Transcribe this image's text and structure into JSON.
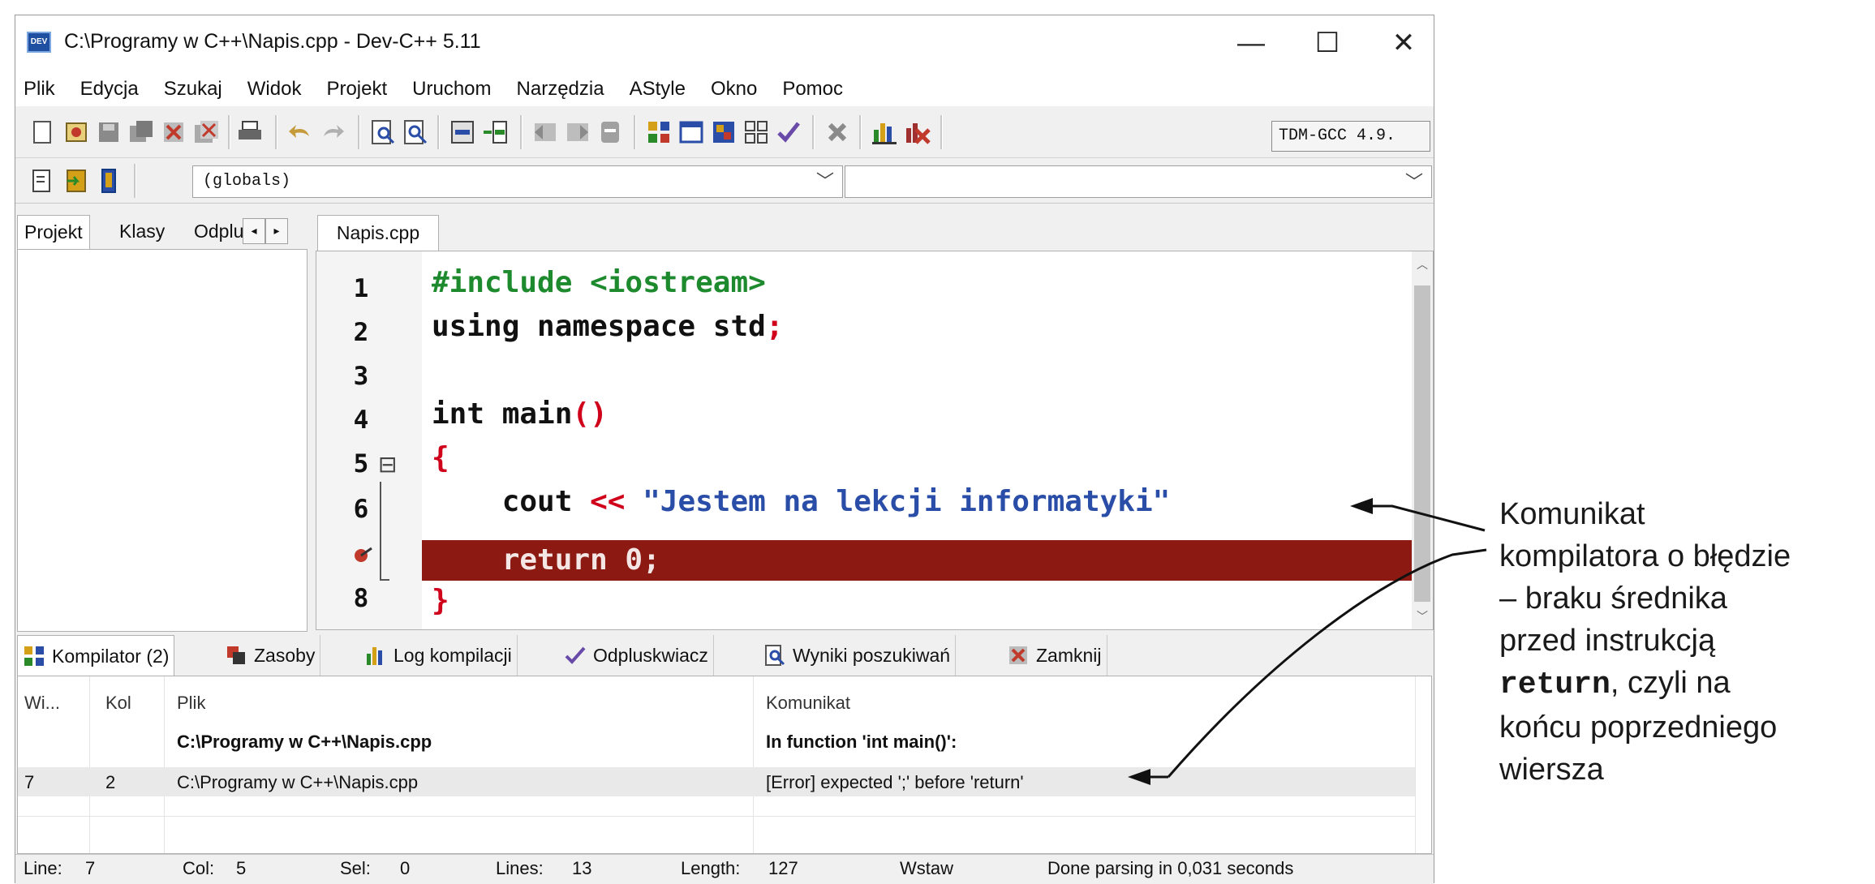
{
  "window": {
    "title": "C:\\Programy w C++\\Napis.cpp - Dev-C++ 5.11",
    "app_icon_text": "DEV",
    "controls": {
      "minimize": "—",
      "maximize": "☐",
      "close": "✕"
    }
  },
  "menu": [
    "Plik",
    "Edycja",
    "Szukaj",
    "Widok",
    "Projekt",
    "Uruchom",
    "Narzędzia",
    "AStyle",
    "Okno",
    "Pomoc"
  ],
  "toolbar": {
    "compiler": "TDM-GCC 4.9.",
    "scope": "(globals)",
    "function": ""
  },
  "left_panel": {
    "tabs": [
      "Projekt",
      "Klasy",
      "Odpluskwiacz"
    ],
    "nav_left": "◂",
    "nav_right": "▸"
  },
  "editor": {
    "tab": "Napis.cpp",
    "line_numbers": [
      "1",
      "2",
      "3",
      "4",
      "5",
      "6",
      "",
      "8"
    ],
    "fold_open": "⊟",
    "fold_end": "└",
    "lines": {
      "l1": "#include <iostream>",
      "l2a": "using namespace std",
      "l2b": ";",
      "l4a": "int main",
      "l4b": "()",
      "l5": "{",
      "l6a": "    cout ",
      "l6b": "<<",
      "l6c": " \"Jestem na lekcji informatyki\"",
      "l7": "    return 0;",
      "l8": "}"
    },
    "error_line_index": 7
  },
  "bottom_tabs": [
    "Kompilator (2)",
    "Zasoby",
    "Log kompilacji",
    "Odpluskwiacz",
    "Wyniki poszukiwań",
    "Zamknij"
  ],
  "messages": {
    "headers": [
      "Wi...",
      "Kol",
      "Plik",
      "Komunikat"
    ],
    "rows": [
      {
        "line": "",
        "col": "",
        "file": "C:\\Programy w C++\\Napis.cpp",
        "message": "In function 'int main()':",
        "bold": true
      },
      {
        "line": "7",
        "col": "2",
        "file": "C:\\Programy w C++\\Napis.cpp",
        "message": "[Error] expected ';' before 'return'",
        "bold": false
      }
    ]
  },
  "status": {
    "line_label": "Line:",
    "line": "7",
    "col_label": "Col:",
    "col": "5",
    "sel_label": "Sel:",
    "sel": "0",
    "lines_label": "Lines:",
    "lines": "13",
    "length_label": "Length:",
    "length": "127",
    "mode": "Wstaw",
    "parse": "Done parsing in 0,031 seconds"
  },
  "annotation": {
    "line1": "Komunikat",
    "line2": "kompilatora o błędzie",
    "line3": "– braku średnika",
    "line4": "przed instrukcją",
    "line5_code": "return",
    "line5_rest": ", czyli na",
    "line6": "końcu poprzedniego",
    "line7": "wiersza"
  },
  "colors": {
    "error_line": "#8c1a12",
    "preprocessor": "#1e8a2e",
    "operator": "#d0021b",
    "string": "#2a4da8"
  }
}
